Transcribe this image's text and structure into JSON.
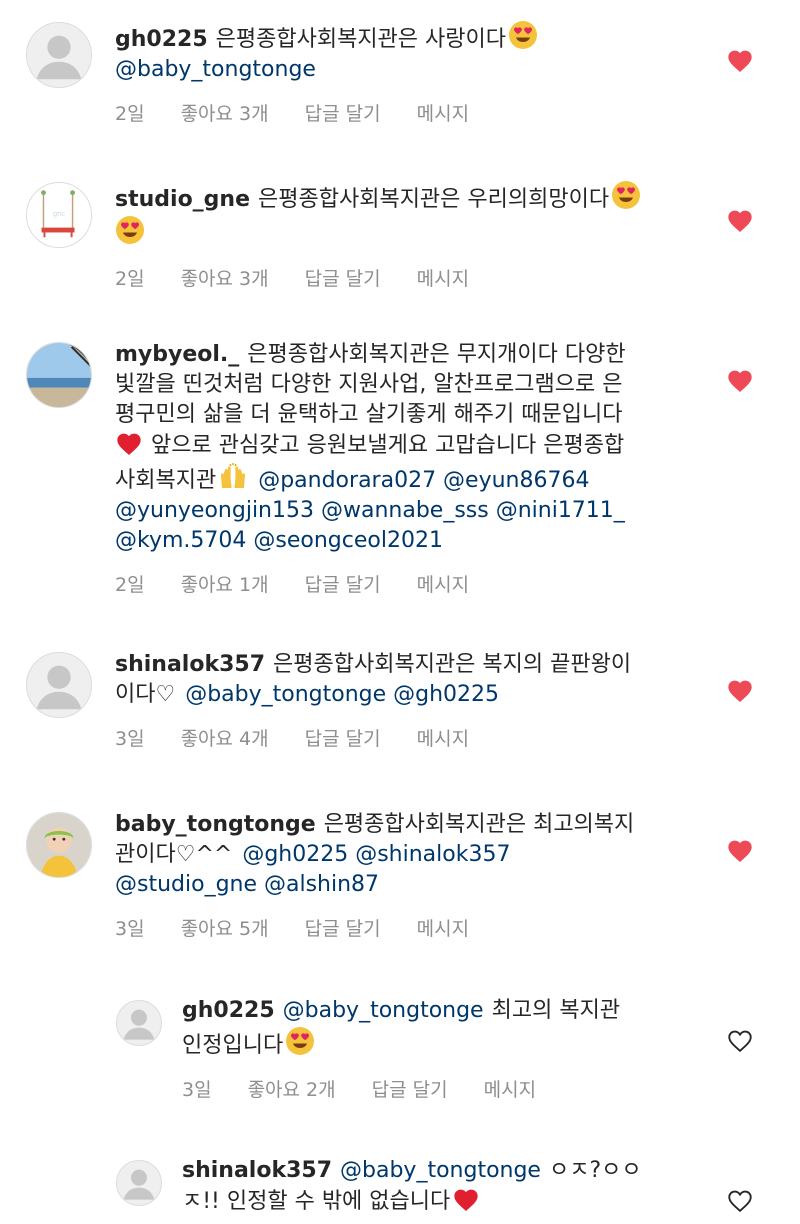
{
  "colors": {
    "heart_liked": "#ed4956",
    "mention": "#00376b",
    "meta": "#8e8e8e",
    "text": "#262626"
  },
  "comments": [
    {
      "username": "gh0225",
      "text": "은평종합사회복지관은 사랑이다",
      "mentions": "@baby_tongtonge",
      "time": "2일",
      "likes": "좋아요 3개",
      "reply": "답글 달기",
      "message": "메시지",
      "liked": true,
      "avatar": "default-avatar"
    },
    {
      "username": "studio_gne",
      "text": "은평종합사회복지관은 우리의희망이다",
      "time": "2일",
      "likes": "좋아요 3개",
      "reply": "답글 달기",
      "message": "메시지",
      "liked": true,
      "avatar": "swing-illustration"
    },
    {
      "username": "mybyeol._",
      "text_line1": "은평종합사회복지관은 무지개이다 다양한",
      "text_line2": "빛깔을 띤것처럼 다양한 지원사업, 알찬프로그램으로 은",
      "text_line3": "평구민의 삶을 더 윤택하고 살기좋게 해주기 때문입니다",
      "text_line4": "앞으로 관심갖고 응원보낼게요 고맙습니다 은평종합",
      "text_line5": "사회복지관",
      "mentions_a": "@pandorara027 @eyun86764",
      "mentions_b": "@yunyeongjin153 @wannabe_sss @nini1711_",
      "mentions_c": "@kym.5704 @seongceol2021",
      "time": "2일",
      "likes": "좋아요 1개",
      "reply": "답글 달기",
      "message": "메시지",
      "liked": true,
      "avatar": "beach-photo"
    },
    {
      "username": "shinalok357",
      "text_line1": "은평종합사회복지관은 복지의 끝판왕이",
      "text_line2": "이다♡",
      "mentions": "@baby_tongtonge @gh0225",
      "time": "3일",
      "likes": "좋아요 4개",
      "reply": "답글 달기",
      "message": "메시지",
      "liked": true,
      "avatar": "default-avatar"
    },
    {
      "username": "baby_tongtonge",
      "text_line1": "은평종합사회복지관은 최고의복지",
      "text_line2": "관이다♡^^",
      "mentions_a": "@gh0225  @shinalok357",
      "mentions_b": "@studio_gne  @alshin87",
      "time": "3일",
      "likes": "좋아요 5개",
      "reply": "답글 달기",
      "message": "메시지",
      "liked": true,
      "avatar": "baby-photo"
    },
    {
      "username": "gh0225",
      "mention": "@baby_tongtonge",
      "text_line1": "최고의 복지관",
      "text_line2": "인정입니다",
      "time": "3일",
      "likes": "좋아요 2개",
      "reply": "답글 달기",
      "message": "메시지",
      "liked": false,
      "avatar": "default-avatar"
    },
    {
      "username": "shinalok357",
      "mention": "@baby_tongtonge",
      "text_line1": "ㅇㅈ?ㅇㅇ",
      "text_line2": "ㅈ!! 인정할 수 밖에 없습니다",
      "liked": false,
      "avatar": "default-avatar"
    }
  ]
}
